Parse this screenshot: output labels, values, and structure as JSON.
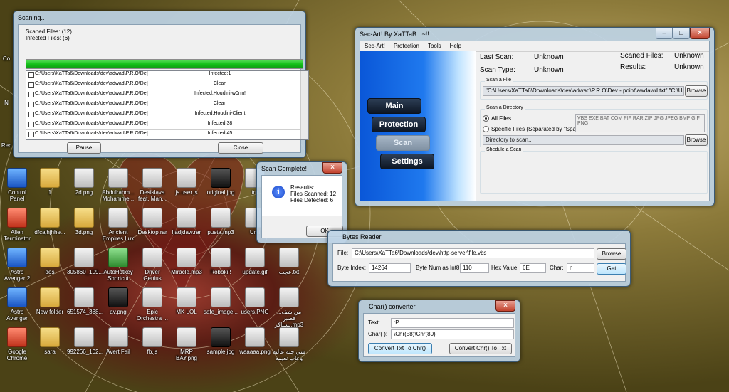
{
  "desktop": {
    "icons": [
      {
        "label": "Control Panel",
        "style": "blue"
      },
      {
        "label": "1",
        "style": "folder"
      },
      {
        "label": "2d.png",
        "style": ""
      },
      {
        "label": "Abdulrahm... Mohamme...",
        "style": ""
      },
      {
        "label": "Desislava feat. Man...",
        "style": ""
      },
      {
        "label": "js.user.js",
        "style": ""
      },
      {
        "label": "original.jpg",
        "style": "dark"
      },
      {
        "label": "tru",
        "style": ""
      },
      {
        "label": "Alien Terminator",
        "style": "red"
      },
      {
        "label": "dfcajhjhhe...",
        "style": "folder"
      },
      {
        "label": "3d.png",
        "style": "folder"
      },
      {
        "label": "Ancient Empires Lux",
        "style": ""
      },
      {
        "label": "Desktop.rar",
        "style": ""
      },
      {
        "label": "ljadjdaw.rar",
        "style": ""
      },
      {
        "label": "pusta.mp3",
        "style": ""
      },
      {
        "label": "Unti",
        "style": ""
      },
      {
        "label": "Astro Avenger 2",
        "style": "blue"
      },
      {
        "label": "dos",
        "style": "folder"
      },
      {
        "label": "305860_109...",
        "style": ""
      },
      {
        "label": "AutoHotkey Shortcut",
        "style": "green"
      },
      {
        "label": "Driver Genius",
        "style": ""
      },
      {
        "label": "Miracle.mp3",
        "style": ""
      },
      {
        "label": "Roboki!!",
        "style": ""
      },
      {
        "label": "update.gif",
        "style": ""
      },
      {
        "label": "عجب.txt",
        "style": ""
      },
      {
        "label": "Astro Avenger",
        "style": "blue"
      },
      {
        "label": "New folder",
        "style": "folder"
      },
      {
        "label": "651574_388...",
        "style": ""
      },
      {
        "label": "av.png",
        "style": "dark"
      },
      {
        "label": "Epic Orchestra ...",
        "style": ""
      },
      {
        "label": "MK LOL",
        "style": ""
      },
      {
        "label": "safe_image...",
        "style": ""
      },
      {
        "label": "users.PNG",
        "style": ""
      },
      {
        "label": "من شف... فصبر بستاكر.mp3",
        "style": ""
      },
      {
        "label": "Google Chrome",
        "style": "red"
      },
      {
        "label": "sara",
        "style": "folder"
      },
      {
        "label": "992266_102...",
        "style": ""
      },
      {
        "label": "Avert Fail",
        "style": ""
      },
      {
        "label": "fb.js",
        "style": ""
      },
      {
        "label": "MRP BAY.png",
        "style": ""
      },
      {
        "label": "sample.jpg",
        "style": "dark"
      },
      {
        "label": "waaaaa.png",
        "style": ""
      },
      {
        "label": "شي جنة عالية وعاب نعيمه",
        "style": ""
      }
    ],
    "edge_labels": [
      "Co",
      "N",
      "Rec"
    ]
  },
  "scanning": {
    "title": "Scaning..",
    "scanned_files": "Scaned Files: (12)",
    "infected_files": "Infected Files: (6)",
    "progress": 1.0,
    "rows": [
      {
        "path": "C:\\Users\\XaTTa6\\Downloads\\dev\\adwad\\P.R.O\\Dev...",
        "result": "Infected:1"
      },
      {
        "path": "C:\\Users\\XaTTa6\\Downloads\\dev\\adwad\\P.R.O\\Dev...",
        "result": "Clean"
      },
      {
        "path": "C:\\Users\\XaTTa6\\Downloads\\dev\\adwad\\P.R.O\\Dev...",
        "result": "Infected:Houdini-w0rm!"
      },
      {
        "path": "C:\\Users\\XaTTa6\\Downloads\\dev\\adwad\\P.R.O\\Dev...",
        "result": "Clean"
      },
      {
        "path": "C:\\Users\\XaTTa6\\Downloads\\dev\\adwad\\P.R.O\\Dev...",
        "result": "Infected:Houdini-Client"
      },
      {
        "path": "C:\\Users\\XaTTa6\\Downloads\\dev\\adwad\\P.R.O\\Dev...",
        "result": "Infected:38"
      },
      {
        "path": "C:\\Users\\XaTTa6\\Downloads\\dev\\adwad\\P.R.O\\Dev...",
        "result": "Infected:45"
      }
    ],
    "pause_label": "Pause",
    "close_label": "Close"
  },
  "scan_complete": {
    "title": "Scan Complete!",
    "line1": "Resaults:",
    "line2": "Files Scanned: 12",
    "line3": "Files Detected: 6",
    "ok_label": "OK",
    "info_glyph": "i"
  },
  "secart": {
    "title": "Sec-Art! By XaTTaB ..~!!",
    "menu": [
      "Sec-Art!",
      "Protection",
      "Tools",
      "Help"
    ],
    "nav": {
      "main": "Main",
      "protection": "Protection",
      "scan": "Scan",
      "settings": "Settings"
    },
    "last_scan_label": "Last Scan:",
    "last_scan_value": "Unknown",
    "scan_type_label": "Scan Type:",
    "scan_type_value": "Unknown",
    "scanned_files_label": "Scaned Files:",
    "scanned_files_value": "Unknown",
    "results_label": "Results:",
    "results_value": "Unknown",
    "scan_file_group": "Scan a File",
    "scan_file_value": "\"C:\\Users\\XaTTa6\\Downloads\\dev\\adwad\\P.R.O\\Dev - point\\awdawd.txt\",\"C:\\Users\\XaTTa",
    "browse_label": "Browse",
    "scan_dir_group": "Scan a Directory",
    "all_files_label": "All Files",
    "specific_files_label": "Specific Files (Separated by \"Space\")",
    "extensions": "VBS EXE BAT COM PIF RAR ZIP JPG JPEG BMP GIF PNG",
    "dir_placeholder": "Directory to scan..",
    "browse2_label": "Browse",
    "schedule_group": "Shedule a Scan"
  },
  "bytes_reader": {
    "title": "Bytes Reader",
    "file_label": "File:",
    "file_value": "C:\\Users\\XaTTa6\\Downloads\\dev\\http-server\\file.vbs",
    "browse_label": "Browse",
    "byte_index_label": "Byte Index:",
    "byte_index_value": "14264",
    "byte_num_label": "Byte Num as Int8:",
    "byte_num_value": "110",
    "hex_label": "Hex Value:",
    "hex_value": "6E",
    "char_label": "Char:",
    "char_value": "n",
    "get_label": "Get"
  },
  "char_converter": {
    "title": "Char() converter",
    "text_label": "Text:",
    "text_value": ":P",
    "char_label": "Char( ):",
    "char_value": "\\Chr(58)\\Chr(80)",
    "to_chr_label": "Convert Txt To Chr()",
    "to_txt_label": "Convert Chr() To Txt"
  },
  "colors": {
    "title_blue": "#bed4e6",
    "close_red": "#c2422d",
    "progress_green": "#15c21a",
    "sidepanel_blue": "#0a57d8"
  }
}
